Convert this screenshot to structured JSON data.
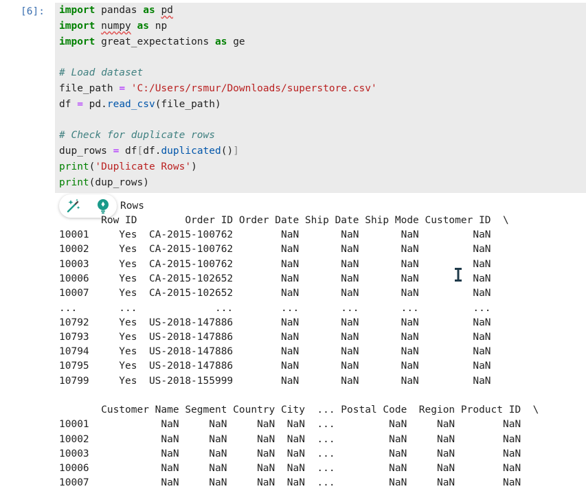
{
  "cell": {
    "prompt": "[6]:",
    "code": {
      "l1": {
        "kw1": "import",
        "t1": " ",
        "mod": "pandas",
        "t2": " ",
        "kw2": "as",
        "t3": " ",
        "alias": "pd"
      },
      "l2": {
        "kw1": "import",
        "t1": " ",
        "mod": "numpy",
        "t2": " ",
        "kw2": "as",
        "t3": " ",
        "alias": "np"
      },
      "l3": {
        "kw1": "import",
        "t1": " great_expectations ",
        "kw2": "as",
        "t2": " ge"
      },
      "l4": {
        "comment": "# Load dataset"
      },
      "l5": {
        "var": "file_path ",
        "op": "=",
        "sp": " ",
        "str": "'C:/Users/rsmur/Downloads/superstore.csv'"
      },
      "l6": {
        "var": "df ",
        "op": "=",
        "obj": " pd.",
        "fn": "read_csv",
        "arg": "(file_path)"
      },
      "l7": {
        "comment": "# Check for duplicate rows"
      },
      "l8": {
        "var": "dup_rows ",
        "op": "=",
        "obj": " df",
        "b1": "[",
        "mid": "df.",
        "fn": "duplicated",
        "call": "()",
        "b2": "]"
      },
      "l9": {
        "fn": "print",
        "p1": "(",
        "str": "'Duplicate Rows'",
        "p2": ")"
      },
      "l10": {
        "fn": "print",
        "arg": "(dup_rows)"
      }
    }
  },
  "toolbar": {
    "magic_icon": "magic-wand-sparkle",
    "lightbulb_icon": "lightbulb"
  },
  "output": {
    "partial_title": "Rows",
    "table1_header": "       Row ID        Order ID Order Date Ship Date Ship Mode Customer ID  \\",
    "table1_rows": [
      "10001     Yes  CA-2015-100762        NaN       NaN       NaN         NaN",
      "10002     Yes  CA-2015-100762        NaN       NaN       NaN         NaN",
      "10003     Yes  CA-2015-100762        NaN       NaN       NaN         NaN",
      "10006     Yes  CA-2015-102652        NaN       NaN       NaN         NaN",
      "10007     Yes  CA-2015-102652        NaN       NaN       NaN         NaN",
      "...       ...             ...        ...       ...       ...         ...",
      "10792     Yes  US-2018-147886        NaN       NaN       NaN         NaN",
      "10793     Yes  US-2018-147886        NaN       NaN       NaN         NaN",
      "10794     Yes  US-2018-147886        NaN       NaN       NaN         NaN",
      "10795     Yes  US-2018-147886        NaN       NaN       NaN         NaN",
      "10799     Yes  US-2018-155999        NaN       NaN       NaN         NaN"
    ],
    "table2_header": "       Customer Name Segment Country City  ... Postal Code  Region Product ID  \\",
    "table2_rows": [
      "10001            NaN     NaN     NaN  NaN  ...         NaN     NaN        NaN",
      "10002            NaN     NaN     NaN  NaN  ...         NaN     NaN        NaN",
      "10003            NaN     NaN     NaN  NaN  ...         NaN     NaN        NaN",
      "10006            NaN     NaN     NaN  NaN  ...         NaN     NaN        NaN",
      "10007            NaN     NaN     NaN  NaN  ...         NaN     NaN        NaN"
    ]
  },
  "colors": {
    "cell_bg": "#ebebeb",
    "prompt": "#3a6fb0",
    "keyword": "#008000",
    "comment": "#408080",
    "string": "#ba2121",
    "operator": "#aa22ff",
    "ibeam_cursor": "#1f3a4a",
    "lightbulb": "#1a9a8a"
  }
}
